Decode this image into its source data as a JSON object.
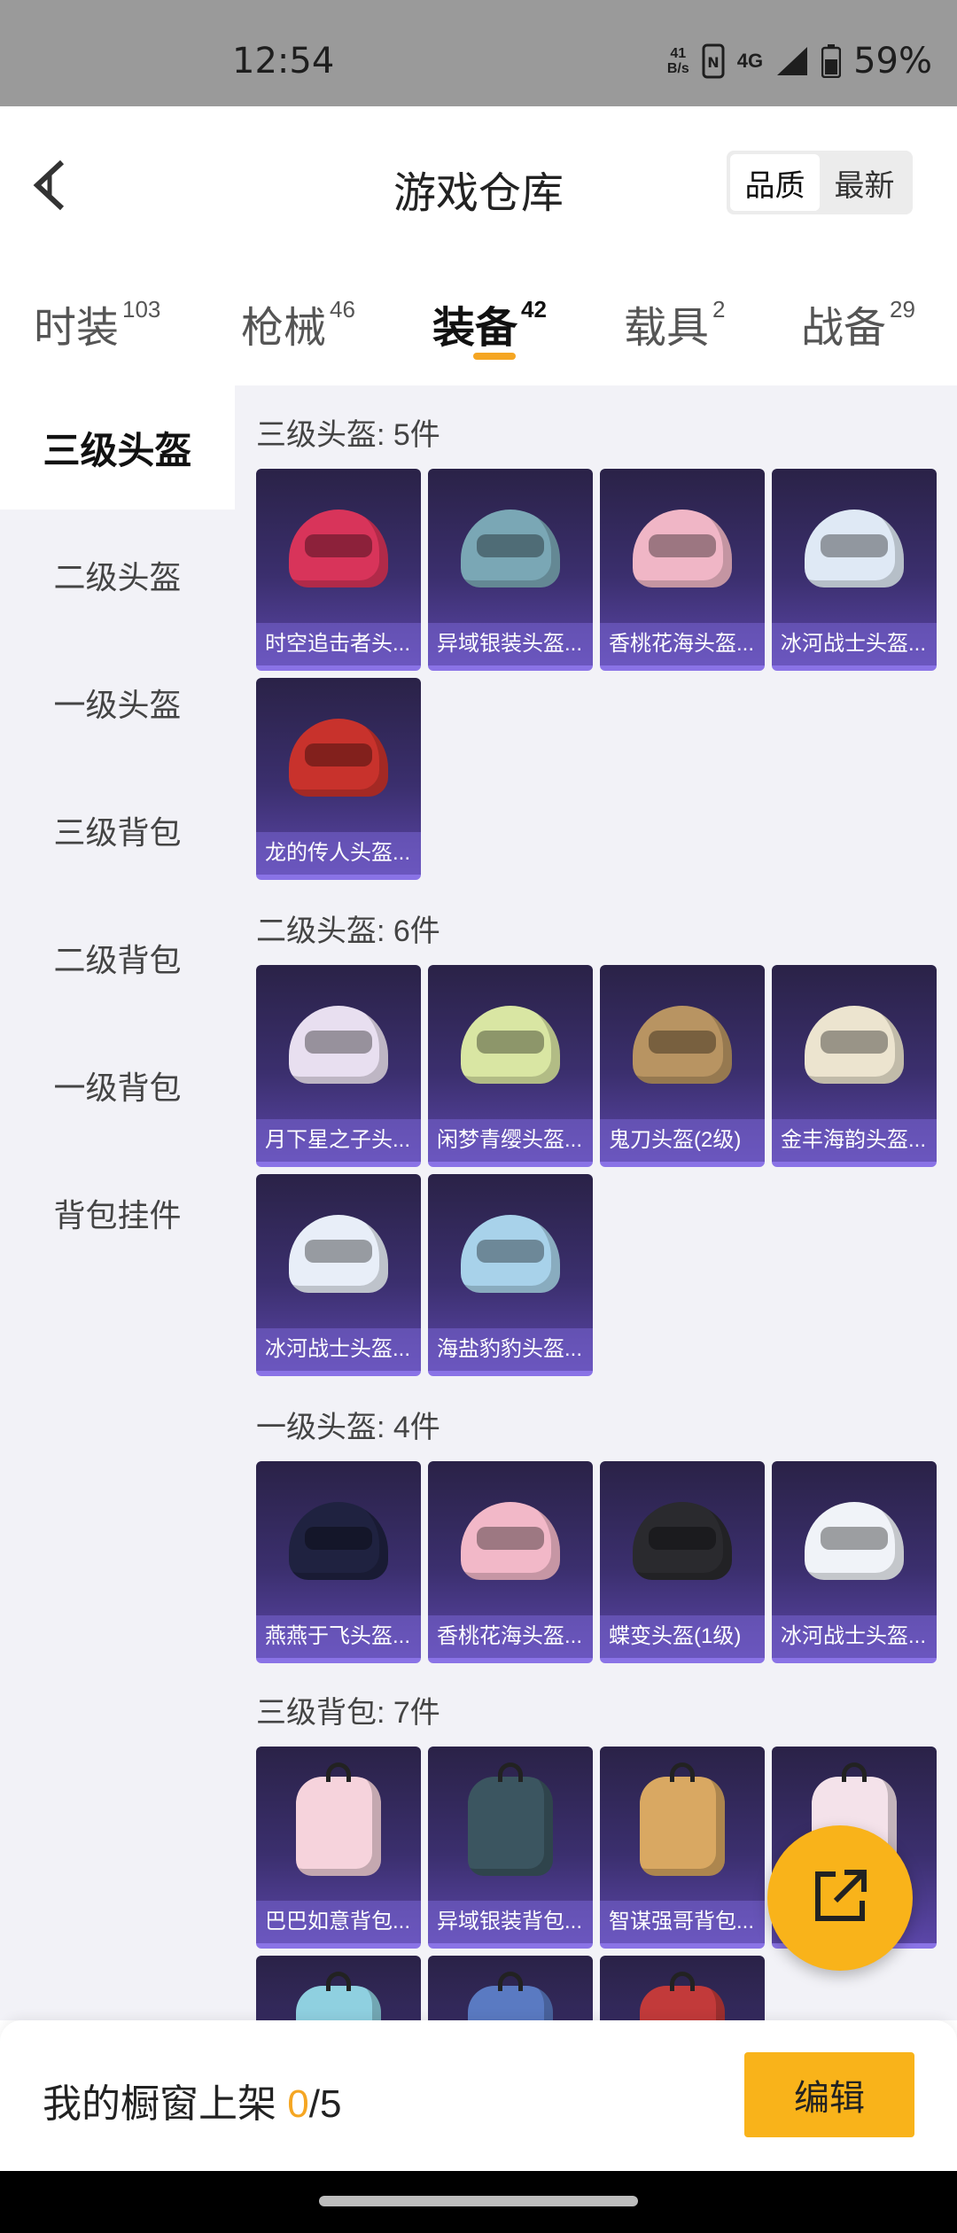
{
  "status_bar": {
    "time": "12:54",
    "net_speed_value": "41",
    "net_speed_unit": "B/s",
    "network": "4G",
    "battery": "59%"
  },
  "header": {
    "title": "游戏仓库",
    "sort_options": [
      "品质",
      "最新"
    ],
    "active_sort": "品质"
  },
  "tabs": [
    {
      "label": "时装",
      "count": "103"
    },
    {
      "label": "枪械",
      "count": "46"
    },
    {
      "label": "装备",
      "count": "42",
      "active": true
    },
    {
      "label": "载具",
      "count": "2"
    },
    {
      "label": "战备",
      "count": "29"
    }
  ],
  "sidebar": {
    "items": [
      "三级头盔",
      "二级头盔",
      "一级头盔",
      "三级背包",
      "二级背包",
      "一级背包",
      "背包挂件"
    ],
    "active": "三级头盔"
  },
  "sections": [
    {
      "title": "三级头盔: 5件",
      "items": [
        {
          "name": "时空追击者头...",
          "color": "#d8345a",
          "kind": "helmet"
        },
        {
          "name": "异域银装头盔...",
          "color": "#7aa7b5",
          "kind": "helmet"
        },
        {
          "name": "香桃花海头盔...",
          "color": "#f0b6c6",
          "kind": "helmet"
        },
        {
          "name": "冰河战士头盔...",
          "color": "#dfe9f5",
          "kind": "helmet"
        },
        {
          "name": "龙的传人头盔...",
          "color": "#c8322c",
          "kind": "helmet"
        }
      ]
    },
    {
      "title": "二级头盔: 6件",
      "items": [
        {
          "name": "月下星之子头...",
          "color": "#e8dff0",
          "kind": "helmet"
        },
        {
          "name": "闲梦青缨头盔...",
          "color": "#d9e6a3",
          "kind": "helmet"
        },
        {
          "name": "鬼刀头盔(2级)",
          "color": "#b89462",
          "kind": "helmet"
        },
        {
          "name": "金丰海韵头盔...",
          "color": "#ece4cf",
          "kind": "helmet"
        },
        {
          "name": "冰河战士头盔...",
          "color": "#e8eef8",
          "kind": "helmet"
        },
        {
          "name": "海盐豹豹头盔...",
          "color": "#a8d2ea",
          "kind": "helmet"
        }
      ]
    },
    {
      "title": "一级头盔: 4件",
      "items": [
        {
          "name": "燕燕于飞头盔...",
          "color": "#1f2240",
          "kind": "helmet"
        },
        {
          "name": "香桃花海头盔...",
          "color": "#f2b8c8",
          "kind": "helmet"
        },
        {
          "name": "蝶变头盔(1级)",
          "color": "#2a2a2e",
          "kind": "helmet"
        },
        {
          "name": "冰河战士头盔...",
          "color": "#f0f3f8",
          "kind": "helmet"
        }
      ]
    },
    {
      "title": "三级背包: 7件",
      "items": [
        {
          "name": "巴巴如意背包...",
          "color": "#f6d3dc",
          "kind": "pack"
        },
        {
          "name": "异域银装背包...",
          "color": "#3b5560",
          "kind": "pack"
        },
        {
          "name": "智谋强哥背包...",
          "color": "#d9a862",
          "kind": "pack"
        },
        {
          "name": "",
          "color": "#f4e2ea",
          "kind": "pack"
        },
        {
          "name": "",
          "color": "#8fd0e0",
          "kind": "pack"
        },
        {
          "name": "",
          "color": "#5a7ac2",
          "kind": "pack"
        },
        {
          "name": "",
          "color": "#c23a3a",
          "kind": "pack"
        }
      ]
    }
  ],
  "bottom": {
    "shelf_label": "我的橱窗上架",
    "shelf_current": "0",
    "shelf_total": "/5",
    "edit_label": "编辑"
  },
  "colors": {
    "accent": "#f9b31a",
    "card_top": "#2a2247",
    "card_bottom": "#5b46a8"
  },
  "icons": {
    "back": "chevron-left-icon",
    "share": "external-link-icon"
  }
}
